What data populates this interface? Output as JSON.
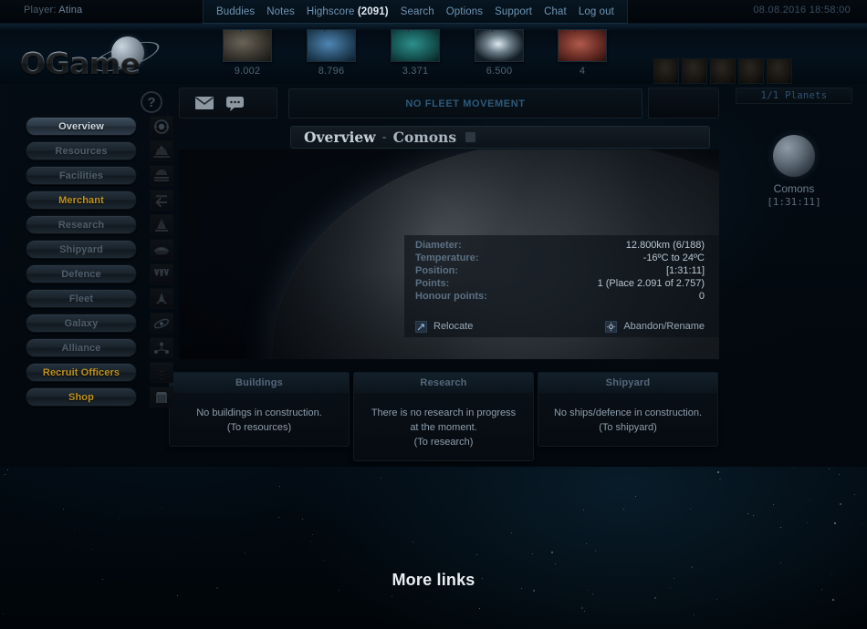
{
  "topbar": {
    "player_prefix": "Player:",
    "player_name": "Atina",
    "server_time": "08.08.2016 18:58:00",
    "menu": [
      {
        "label": "Buddies",
        "name": "buddies"
      },
      {
        "label": "Notes",
        "name": "notes"
      },
      {
        "label": "Highscore",
        "count": "(2091)",
        "name": "highscore"
      },
      {
        "label": "Search",
        "name": "search"
      },
      {
        "label": "Options",
        "name": "options"
      },
      {
        "label": "Support",
        "name": "support"
      },
      {
        "label": "Chat",
        "name": "chat"
      },
      {
        "label": "Log out",
        "name": "logout"
      }
    ]
  },
  "brand": {
    "name": "OGame",
    "help_glyph": "?"
  },
  "resources": [
    {
      "key": "metal",
      "icon": "metal-icon",
      "amount": "9.002"
    },
    {
      "key": "crystal",
      "icon": "crystal-icon",
      "amount": "8.796"
    },
    {
      "key": "deut",
      "icon": "deuterium-icon",
      "amount": "3.371"
    },
    {
      "key": "energy",
      "icon": "energy-icon",
      "amount": "6.500"
    },
    {
      "key": "dm",
      "icon": "dark-matter-icon",
      "amount": "4"
    }
  ],
  "officers": [
    {
      "name": "commander"
    },
    {
      "name": "admiral"
    },
    {
      "name": "engineer"
    },
    {
      "name": "geologist"
    },
    {
      "name": "technocrat"
    }
  ],
  "sidebar": {
    "items": [
      {
        "label": "Overview",
        "state": "active",
        "icon": "overview-icon"
      },
      {
        "label": "Resources",
        "state": "normal",
        "icon": "resources-icon"
      },
      {
        "label": "Facilities",
        "state": "normal",
        "icon": "facilities-icon"
      },
      {
        "label": "Merchant",
        "state": "premium",
        "icon": "merchant-icon"
      },
      {
        "label": "Research",
        "state": "normal",
        "icon": "research-icon"
      },
      {
        "label": "Shipyard",
        "state": "normal",
        "icon": "shipyard-icon"
      },
      {
        "label": "Defence",
        "state": "normal",
        "icon": "defence-icon"
      },
      {
        "label": "Fleet",
        "state": "normal",
        "icon": "fleet-icon"
      },
      {
        "label": "Galaxy",
        "state": "normal",
        "icon": "galaxy-icon"
      },
      {
        "label": "Alliance",
        "state": "normal",
        "icon": "alliance-icon"
      },
      {
        "label": "Recruit Officers",
        "state": "premium",
        "icon": "officers-icon"
      },
      {
        "label": "Shop",
        "state": "premium",
        "icon": "shop-icon"
      }
    ]
  },
  "toolbar": {
    "messages_icon": "mail-icon",
    "chat_icon": "speech-bubble-icon",
    "fleet_status": "NO FLEET MOVEMENT"
  },
  "page": {
    "title": "Overview",
    "separator": "-",
    "planet_title": "Comons"
  },
  "planet_stats": {
    "rows": [
      {
        "key": "Diameter:",
        "value": "12.800km (6/188)"
      },
      {
        "key": "Temperature:",
        "value": "-16ºC to 24ºC"
      },
      {
        "key": "Position:",
        "value": "[1:31:11]"
      },
      {
        "key": "Points:",
        "value": "1 (Place 2.091 of 2.757)"
      },
      {
        "key": "Honour points:",
        "value": "0"
      }
    ],
    "actions": [
      {
        "label": "Relocate",
        "icon": "relocate-icon"
      },
      {
        "label": "Abandon/Rename",
        "icon": "gear-icon"
      }
    ]
  },
  "planet_tabs": [
    {
      "name": "planet-view-tab",
      "icon": "planet-icon",
      "selected": false
    },
    {
      "name": "moon-create-tab",
      "icon": "add-square-icon",
      "selected": true
    }
  ],
  "cards": [
    {
      "title": "Buildings",
      "lines": [
        "No buildings in construction.",
        "(To resources)"
      ]
    },
    {
      "title": "Research",
      "lines": [
        "There is no research in progress",
        "at the moment.",
        "(To research)"
      ]
    },
    {
      "title": "Shipyard",
      "lines": [
        "No ships/defence in construction.",
        "(To shipyard)"
      ]
    }
  ],
  "right_panel": {
    "planet_count": "1/1 Planets",
    "planet_name": "Comons",
    "planet_coords": "[1:31:11]"
  },
  "footer": {
    "more_links": "More links"
  },
  "colors": {
    "accent_gold": "#c09320",
    "accent_blue": "#2e5a7c",
    "text_primary": "#c5cfd8",
    "text_muted": "#4e5c69",
    "background": "#02070c"
  }
}
